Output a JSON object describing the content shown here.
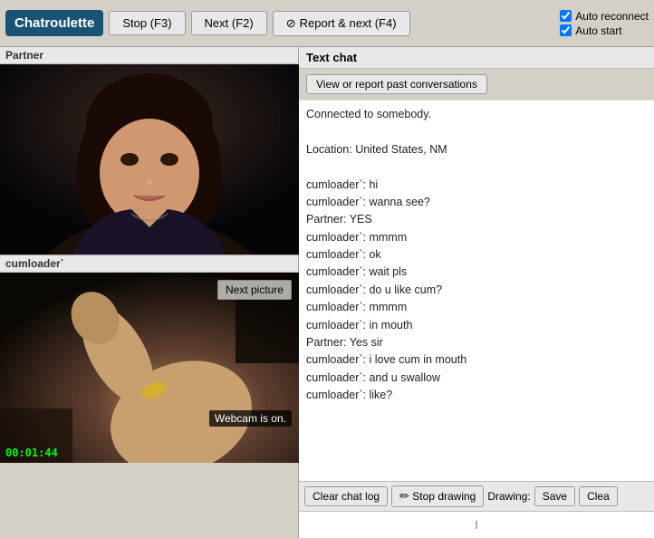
{
  "logo": {
    "label": "Chatroulette"
  },
  "topbar": {
    "stop_btn": "Stop (F3)",
    "next_btn": "Next (F2)",
    "report_btn": "Report & next (F4)",
    "auto_reconnect": "Auto reconnect",
    "auto_start": "Auto start",
    "auto_reconnect_checked": true,
    "auto_start_checked": true
  },
  "left_panel": {
    "partner_label": "Partner",
    "my_label": "cumloader`",
    "next_picture_btn": "Next picture",
    "webcam_status": "Webcam is on.",
    "timer": "00:01:44"
  },
  "right_panel": {
    "title": "Text chat",
    "view_btn": "View or report past conversations",
    "messages": [
      "Connected to somebody.",
      "",
      "Location: United States, NM",
      "",
      "cumloader`: hi",
      "cumloader`: wanna see?",
      "Partner: YES",
      "cumloader`: mmmm",
      "cumloader`: ok",
      "cumloader`: wait pls",
      "cumloader`: do u like cum?",
      "cumloader`: mmmm",
      "cumloader`: in mouth",
      "Partner: Yes sir",
      "cumloader`: i love cum in mouth",
      "cumloader`: and u swallow",
      "cumloader`: like?"
    ],
    "clear_chat_btn": "Clear chat log",
    "stop_drawing_btn": "Stop drawing",
    "drawing_label": "Drawing:",
    "save_btn": "Save",
    "clear_btn": "Clea",
    "input_placeholder": "I"
  }
}
